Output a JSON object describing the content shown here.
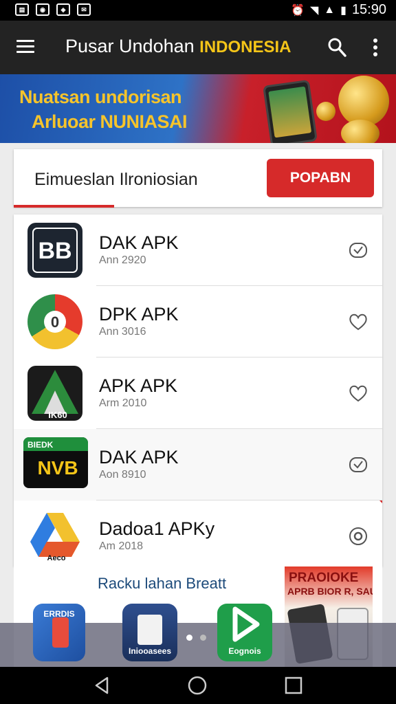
{
  "status_bar": {
    "time": "15:90"
  },
  "app_bar": {
    "title": "Pusar Undohan",
    "title_accent": "INDONESIA",
    "title_accent_color": "#f5c518"
  },
  "banner": {
    "line1": "Nuatsan undorisan",
    "line2": "Arluoar NUNIASAI"
  },
  "section": {
    "title": "Eimueslan Ilroniosian",
    "button_label": "POPABN",
    "accent_color": "#d62a2a"
  },
  "apps": [
    {
      "name": "DAK APK",
      "meta": "Ann 2920",
      "logo_text": "BB",
      "icon": "check-badge-icon"
    },
    {
      "name": "DPK APK",
      "meta": "Ann 3016",
      "logo_text": "0",
      "icon": "heart-icon"
    },
    {
      "name": "APK APK",
      "meta": "Arm 2010",
      "logo_text": "IK60",
      "icon": "heart-icon"
    },
    {
      "name": "DAK APK",
      "meta": "Aon 8910",
      "logo_text": "NVB",
      "logo_subtext": "BIEDK",
      "icon": "check-badge-icon"
    },
    {
      "name": "Dadoa1 APKy",
      "meta": "Am 2018",
      "logo_text": "Aeco",
      "icon": "radio-icon"
    }
  ],
  "recommend": {
    "title": "Racku lahan Breatt",
    "promo_line1": "PRAOIOKE",
    "promo_line2": "APRB BIOR R, SAU"
  },
  "dock": [
    {
      "label": "ERRDIS"
    },
    {
      "label": "Iniooasees"
    },
    {
      "label": "Eognois"
    },
    {
      "label": ""
    }
  ]
}
